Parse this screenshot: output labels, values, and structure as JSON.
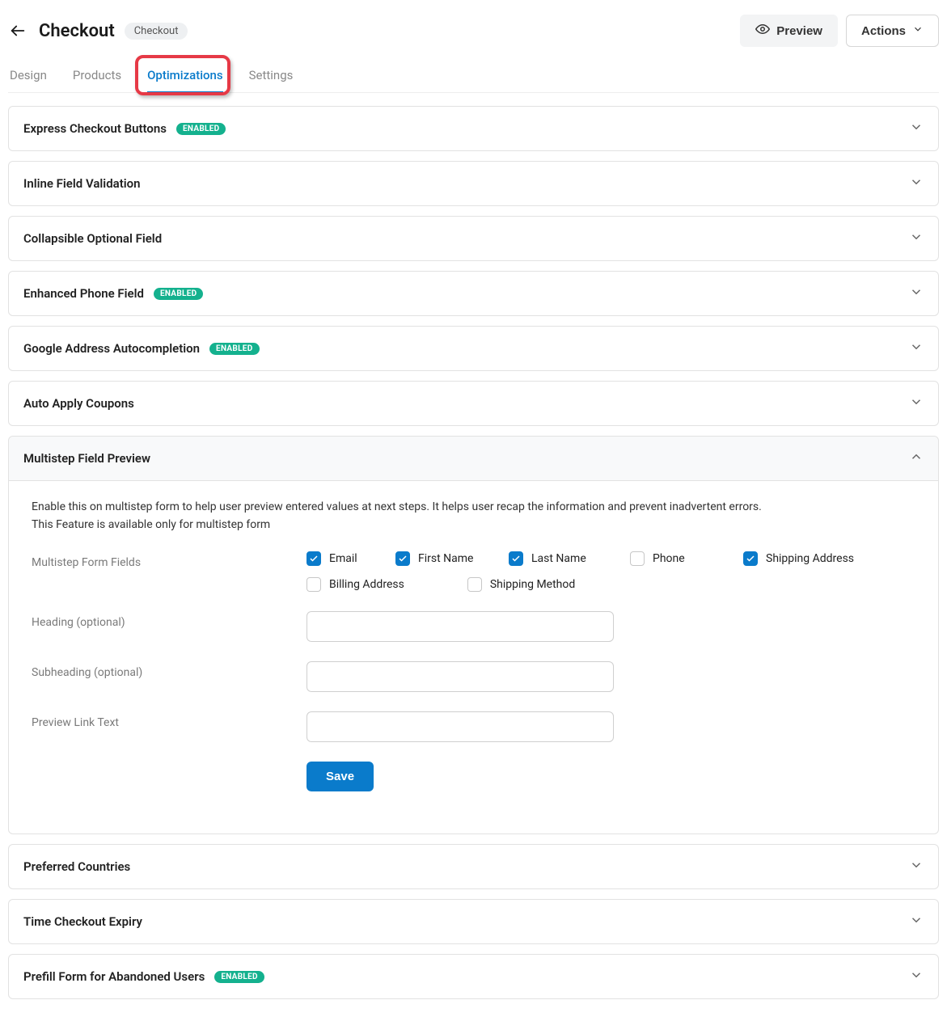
{
  "header": {
    "title": "Checkout",
    "chip": "Checkout",
    "preview_label": "Preview",
    "actions_label": "Actions"
  },
  "tabs": {
    "design": "Design",
    "products": "Products",
    "optimizations": "Optimizations",
    "settings": "Settings",
    "active": "optimizations"
  },
  "enabled_badge": "ENABLED",
  "accordions": {
    "express": {
      "title": "Express Checkout Buttons",
      "enabled": true
    },
    "inline": {
      "title": "Inline Field Validation",
      "enabled": false
    },
    "collapsible": {
      "title": "Collapsible Optional Field",
      "enabled": false
    },
    "phone": {
      "title": "Enhanced Phone Field",
      "enabled": true
    },
    "google": {
      "title": "Google Address Autocompletion",
      "enabled": true
    },
    "coupons": {
      "title": "Auto Apply Coupons",
      "enabled": false
    },
    "multistep": {
      "title": "Multistep Field Preview",
      "open": true
    },
    "countries": {
      "title": "Preferred Countries",
      "enabled": false
    },
    "expiry": {
      "title": "Time Checkout Expiry",
      "enabled": false
    },
    "prefill": {
      "title": "Prefill Form for Abandoned Users",
      "enabled": true
    }
  },
  "multistep": {
    "desc_line1": "Enable this on multistep form to help user preview entered values at next steps. It helps user recap the information and prevent inadvertent errors.",
    "desc_line2": "This Feature is available only for multistep form",
    "fields_label": "Multistep Form Fields",
    "checks": {
      "email": {
        "label": "Email",
        "checked": true
      },
      "first": {
        "label": "First Name",
        "checked": true
      },
      "last": {
        "label": "Last Name",
        "checked": true
      },
      "phone": {
        "label": "Phone",
        "checked": false
      },
      "ship": {
        "label": "Shipping Address",
        "checked": true
      },
      "bill": {
        "label": "Billing Address",
        "checked": false
      },
      "method": {
        "label": "Shipping Method",
        "checked": false
      }
    },
    "heading_label": "Heading (optional)",
    "subheading_label": "Subheading (optional)",
    "linktext_label": "Preview Link Text",
    "heading_value": "",
    "subheading_value": "",
    "linktext_value": "",
    "save_label": "Save"
  }
}
